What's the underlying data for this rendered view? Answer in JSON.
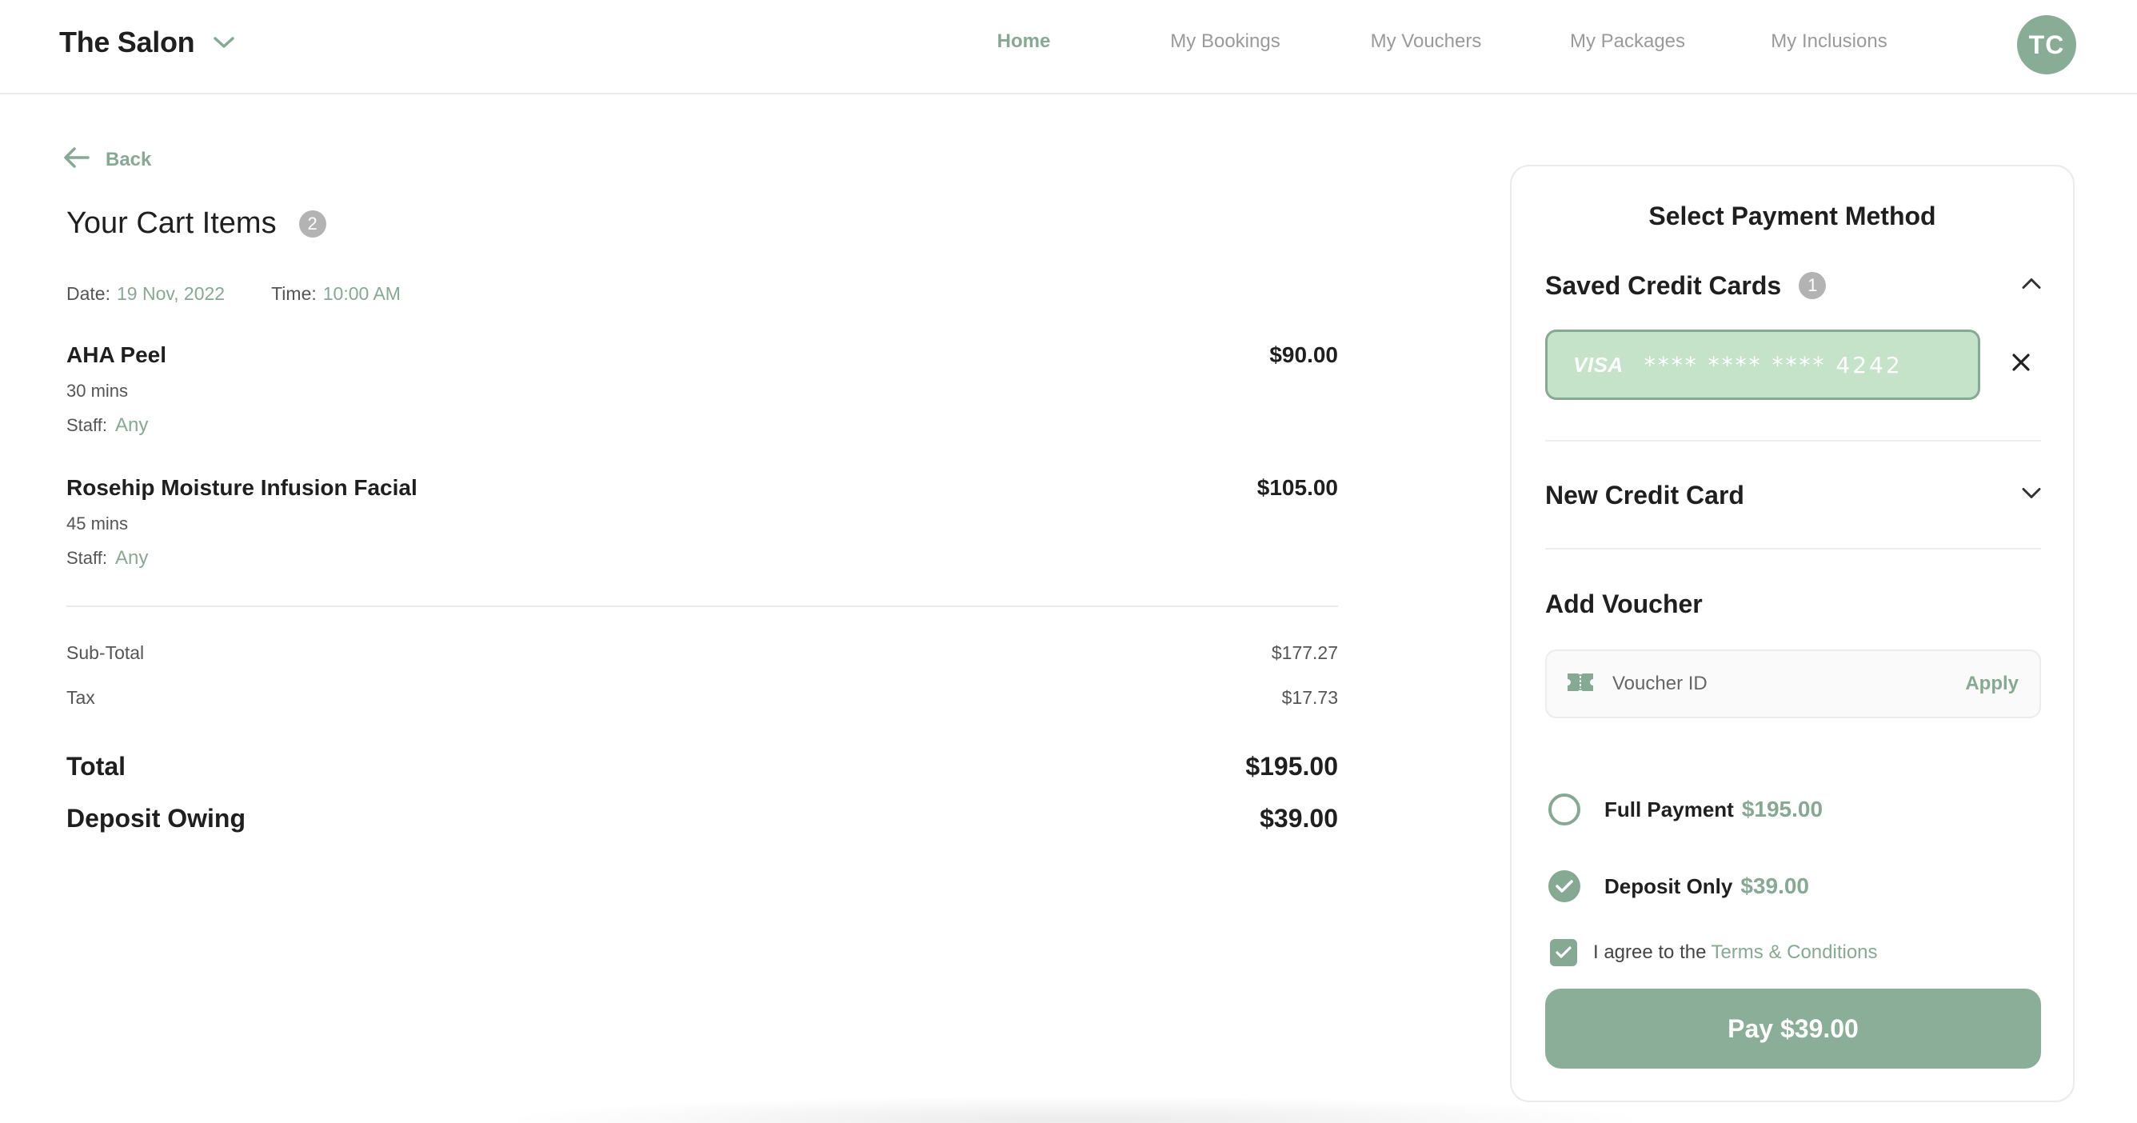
{
  "header": {
    "brand": "The Salon",
    "nav": [
      {
        "label": "Home",
        "active": true
      },
      {
        "label": "My Bookings",
        "active": false
      },
      {
        "label": "My Vouchers",
        "active": false
      },
      {
        "label": "My Packages",
        "active": false
      },
      {
        "label": "My Inclusions",
        "active": false
      }
    ],
    "avatar_initials": "TC"
  },
  "cart": {
    "back_label": "Back",
    "title": "Your Cart Items",
    "count": "2",
    "date_label": "Date:",
    "date_value": "19 Nov, 2022",
    "time_label": "Time:",
    "time_value": "10:00 AM",
    "items": [
      {
        "name": "AHA Peel",
        "duration": "30 mins",
        "staff_label": "Staff:",
        "staff": "Any",
        "price": "$90.00"
      },
      {
        "name": "Rosehip Moisture Infusion Facial",
        "duration": "45 mins",
        "staff_label": "Staff:",
        "staff": "Any",
        "price": "$105.00"
      }
    ],
    "subtotal_label": "Sub-Total",
    "subtotal": "$177.27",
    "tax_label": "Tax",
    "tax": "$17.73",
    "total_label": "Total",
    "total": "$195.00",
    "deposit_label": "Deposit Owing",
    "deposit": "$39.00"
  },
  "payment": {
    "title": "Select Payment Method",
    "saved_cards_label": "Saved Credit Cards",
    "saved_cards_count": "1",
    "card_brand": "VISA",
    "card_number": "**** **** **** 4242",
    "new_card_label": "New Credit Card",
    "voucher_label": "Add Voucher",
    "voucher_placeholder": "Voucher ID",
    "apply_label": "Apply",
    "full_payment_label": "Full Payment",
    "full_payment_amount": "$195.00",
    "full_payment_selected": false,
    "deposit_only_label": "Deposit Only",
    "deposit_only_amount": "$39.00",
    "deposit_only_selected": true,
    "agree_text": "I agree to the",
    "terms_link": "Terms & Conditions",
    "agree_checked": true,
    "pay_button": "Pay $39.00"
  },
  "colors": {
    "accent": "#86a993",
    "card_fill": "#c4e3c9",
    "text": "#1f1f1f",
    "muted": "#9a9a9a"
  },
  "icons": [
    "chevron-down-icon",
    "arrow-left-icon",
    "chevron-up-icon",
    "close-icon",
    "ticket-icon",
    "check-icon"
  ]
}
